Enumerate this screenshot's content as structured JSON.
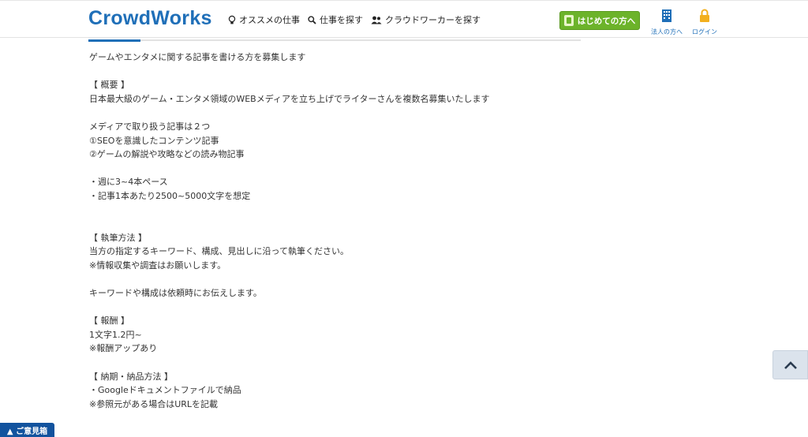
{
  "header": {
    "logo_text": "CrowdWorks",
    "nav": [
      {
        "icon": "lightbulb-icon",
        "label": "オススメの仕事"
      },
      {
        "icon": "search-icon",
        "label": "仕事を探す"
      },
      {
        "icon": "users-icon",
        "label": "クラウドワーカーを探す"
      }
    ],
    "start_button_label": "はじめての方へ",
    "corporate_label": "法人の方へ",
    "login_label": "ログイン"
  },
  "colors": {
    "brand_blue": "#1f6fb8",
    "start_green": "#6cb32a",
    "login_yellow": "#f2b01e",
    "feedback_blue": "#12539e"
  },
  "content": {
    "lines": [
      "ゲームやエンタメに関する記事を書ける方を募集します",
      "",
      "【 概要 】",
      "日本最大級のゲーム・エンタメ領域のWEBメディアを立ち上げでライターさんを複数名募集いたします",
      "",
      "メディアで取り扱う記事は２つ",
      "①SEOを意識したコンテンツ記事",
      "②ゲームの解説や攻略などの読み物記事",
      "",
      "・週に3~4本ペース",
      "・記事1本あたり2500~5000文字を想定",
      "",
      "",
      "【 執筆方法 】",
      "当方の指定するキーワード、構成、見出しに沿って執筆ください。",
      "※情報収集や調査はお願いします。",
      "",
      "キーワードや構成は依頼時にお伝えします。",
      "",
      "【 報酬 】",
      "1文字1.2円~",
      "※報酬アップあり",
      "",
      "【 納期・納品方法 】",
      "・Googleドキュメントファイルで納品",
      "※参照元がある場合はURLを記載"
    ]
  },
  "feedback_label": "▲ ご意見箱"
}
